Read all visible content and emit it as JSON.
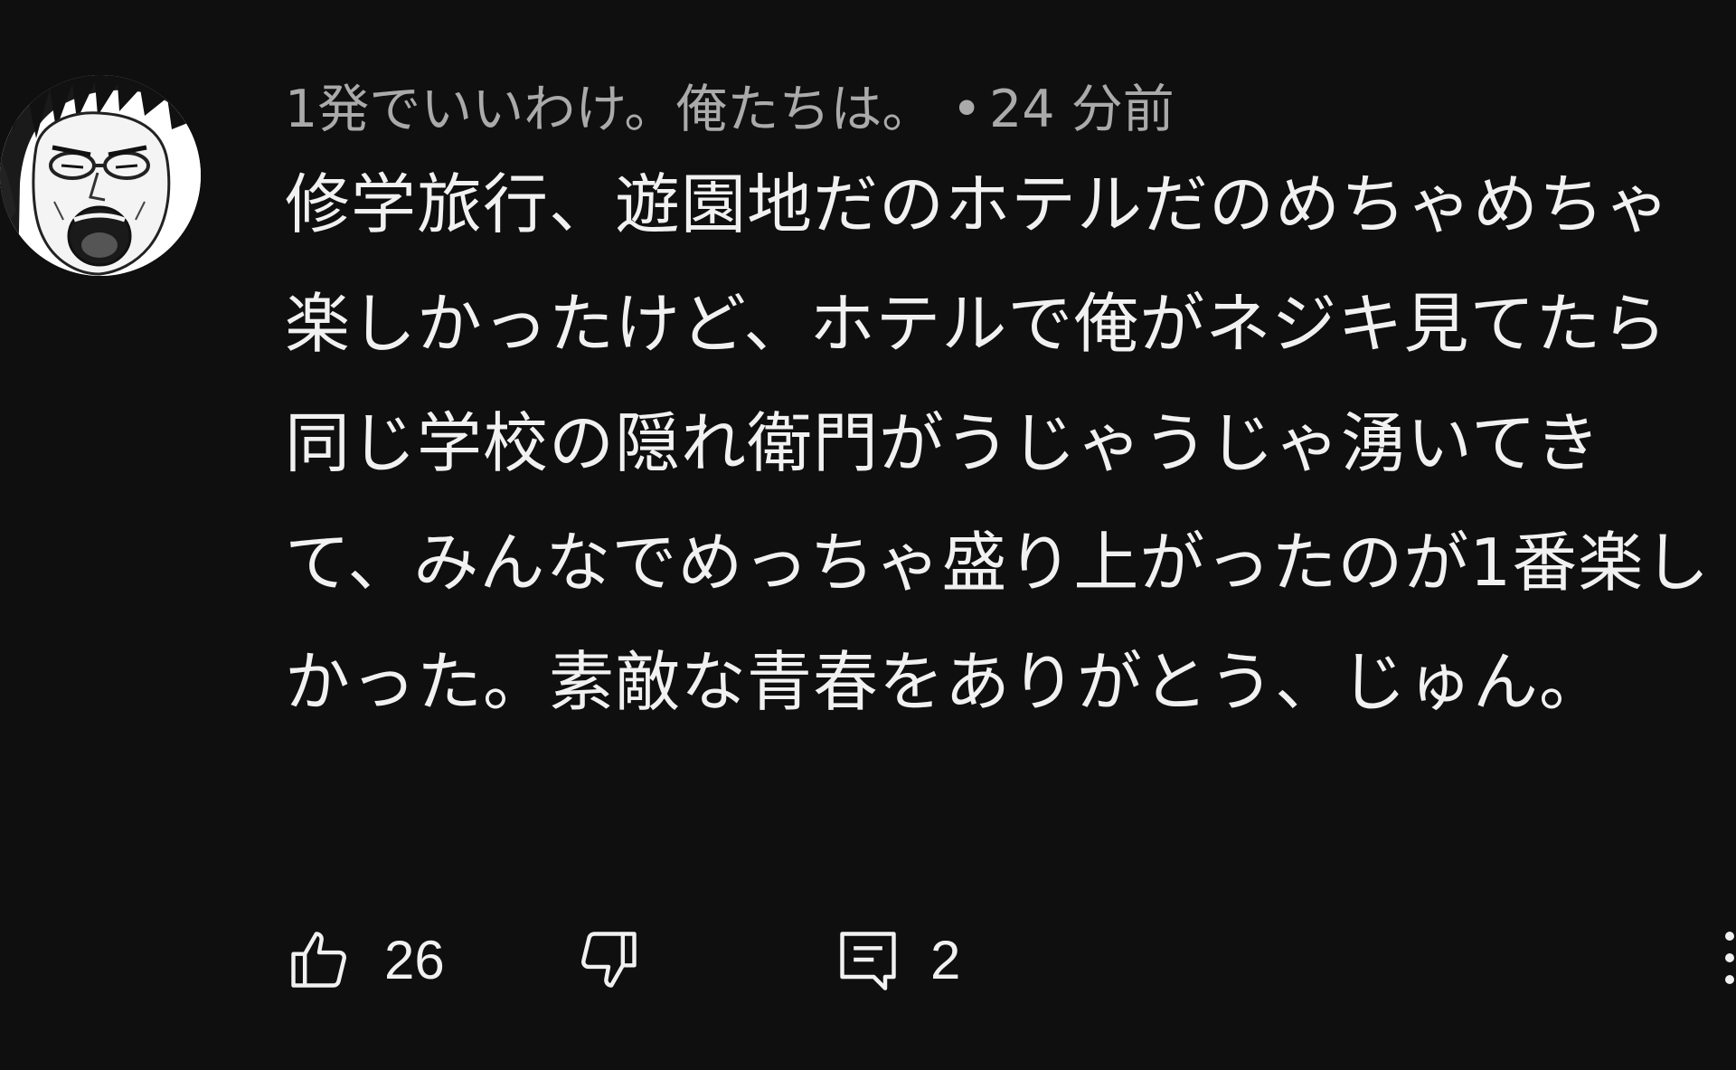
{
  "comment": {
    "author": "1発でいいわけ。俺たちは。",
    "separator": "•",
    "time": "24 分前",
    "text": "修学旅行、遊園地だのホテルだのめちゃめちゃ楽しかったけど、ホテルで俺がネジキ見てたら同じ学校の隠れ衛門がうじゃうじゃ湧いてきて、みんなでめっちゃ盛り上がったのが1番楽しかった。素敵な青春をありがとう、じゅん。",
    "avatar_icon": "manga-face-avatar"
  },
  "actions": {
    "like_icon": "thumbs-up-icon",
    "like_count": "26",
    "dislike_icon": "thumbs-down-icon",
    "reply_icon": "comment-icon",
    "reply_count": "2",
    "more_icon": "more-vertical-icon"
  },
  "colors": {
    "background": "#0f0f0f",
    "text": "#f1f1f1",
    "secondary_text": "#aaaaaa"
  }
}
